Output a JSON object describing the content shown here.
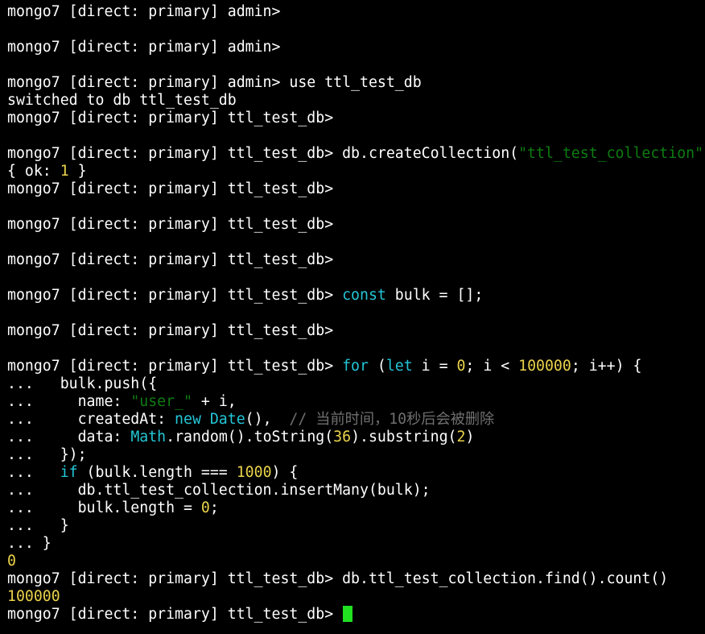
{
  "terminal": {
    "prompt_admin": "mongo7 [direct: primary] admin> ",
    "prompt_db": "mongo7 [direct: primary] ttl_test_db> ",
    "colors": {
      "background": "#000000",
      "text": "#ffffff",
      "keyword": "#23c6d6",
      "string": "#0e7c12",
      "number": "#e9d24a",
      "comment": "#6f6f6f",
      "cursor": "#20e020"
    },
    "lines": [
      [
        {
          "t": "mongo7 [direct: primary] admin> ",
          "c": "default"
        }
      ],
      [],
      [
        {
          "t": "mongo7 [direct: primary] admin> ",
          "c": "default"
        }
      ],
      [],
      [
        {
          "t": "mongo7 [direct: primary] admin> use ttl_test_db",
          "c": "default"
        }
      ],
      [
        {
          "t": "switched to db ttl_test_db",
          "c": "default"
        }
      ],
      [
        {
          "t": "mongo7 [direct: primary] ttl_test_db> ",
          "c": "default"
        }
      ],
      [],
      [
        {
          "t": "mongo7 [direct: primary] ttl_test_db> db.createCollection(",
          "c": "default"
        },
        {
          "t": "\"ttl_test_collection\"",
          "c": "string"
        }
      ],
      [
        {
          "t": "{ ok: ",
          "c": "default"
        },
        {
          "t": "1",
          "c": "number"
        },
        {
          "t": " }",
          "c": "default"
        }
      ],
      [
        {
          "t": "mongo7 [direct: primary] ttl_test_db> ",
          "c": "default"
        }
      ],
      [],
      [
        {
          "t": "mongo7 [direct: primary] ttl_test_db> ",
          "c": "default"
        }
      ],
      [],
      [
        {
          "t": "mongo7 [direct: primary] ttl_test_db> ",
          "c": "default"
        }
      ],
      [],
      [
        {
          "t": "mongo7 [direct: primary] ttl_test_db> ",
          "c": "default"
        },
        {
          "t": "const",
          "c": "keyword"
        },
        {
          "t": " bulk = [];",
          "c": "default"
        }
      ],
      [],
      [
        {
          "t": "mongo7 [direct: primary] ttl_test_db> ",
          "c": "default"
        }
      ],
      [],
      [
        {
          "t": "mongo7 [direct: primary] ttl_test_db> ",
          "c": "default"
        },
        {
          "t": "for",
          "c": "keyword"
        },
        {
          "t": " (",
          "c": "default"
        },
        {
          "t": "let",
          "c": "keyword"
        },
        {
          "t": " i = ",
          "c": "default"
        },
        {
          "t": "0",
          "c": "number"
        },
        {
          "t": "; i < ",
          "c": "default"
        },
        {
          "t": "100000",
          "c": "number"
        },
        {
          "t": "; i++) {",
          "c": "default"
        }
      ],
      [
        {
          "t": "...   bulk.push({",
          "c": "default"
        }
      ],
      [
        {
          "t": "...     name: ",
          "c": "default"
        },
        {
          "t": "\"user_\"",
          "c": "string"
        },
        {
          "t": " + i,",
          "c": "default"
        }
      ],
      [
        {
          "t": "...     createdAt: ",
          "c": "default"
        },
        {
          "t": "new",
          "c": "keyword"
        },
        {
          "t": " ",
          "c": "default"
        },
        {
          "t": "Date",
          "c": "keyword"
        },
        {
          "t": "(),  ",
          "c": "default"
        },
        {
          "t": "// 当前时间，10秒后会被删除",
          "c": "comment"
        }
      ],
      [
        {
          "t": "...     data: ",
          "c": "default"
        },
        {
          "t": "Math",
          "c": "keyword"
        },
        {
          "t": ".random().toString(",
          "c": "default"
        },
        {
          "t": "36",
          "c": "number"
        },
        {
          "t": ").substring(",
          "c": "default"
        },
        {
          "t": "2",
          "c": "number"
        },
        {
          "t": ")",
          "c": "default"
        }
      ],
      [
        {
          "t": "...   });",
          "c": "default"
        }
      ],
      [
        {
          "t": "...   ",
          "c": "default"
        },
        {
          "t": "if",
          "c": "keyword"
        },
        {
          "t": " (bulk.length === ",
          "c": "default"
        },
        {
          "t": "1000",
          "c": "number"
        },
        {
          "t": ") {",
          "c": "default"
        }
      ],
      [
        {
          "t": "...     db.ttl_test_collection.insertMany(bulk);",
          "c": "default"
        }
      ],
      [
        {
          "t": "...     bulk.length = ",
          "c": "default"
        },
        {
          "t": "0",
          "c": "number"
        },
        {
          "t": ";",
          "c": "default"
        }
      ],
      [
        {
          "t": "...   }",
          "c": "default"
        }
      ],
      [
        {
          "t": "... }",
          "c": "default"
        }
      ],
      [
        {
          "t": "0",
          "c": "number"
        }
      ],
      [
        {
          "t": "mongo7 [direct: primary] ttl_test_db> db.ttl_test_collection.find().count()",
          "c": "default"
        }
      ],
      [
        {
          "t": "100000",
          "c": "number"
        }
      ],
      [
        {
          "t": "mongo7 [direct: primary] ttl_test_db> ",
          "c": "default"
        },
        {
          "cursor": true
        }
      ]
    ]
  }
}
